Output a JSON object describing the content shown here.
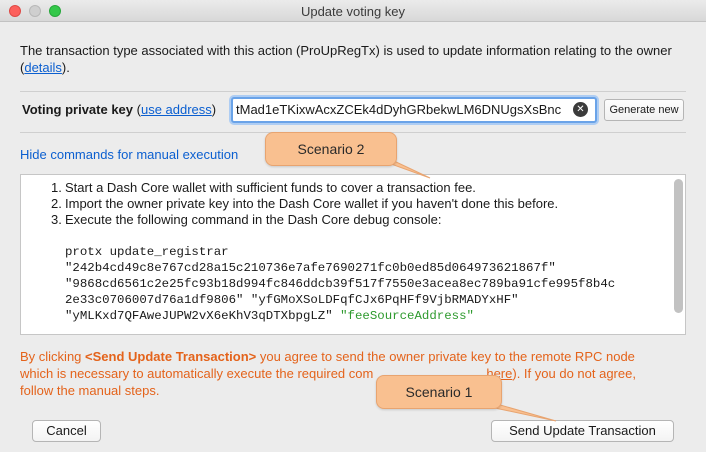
{
  "window": {
    "title": "Update voting key"
  },
  "intro": {
    "text_before_link": "The transaction type associated with this action (ProUpRegTx) is used to update information relating to the owner (",
    "link_text": "details",
    "text_after_link": ")."
  },
  "voting_key": {
    "label": "Voting private key",
    "use_address_prefix": " (",
    "use_address_link": "use address",
    "use_address_suffix": ")",
    "value": "tMad1eTKixwAcxZCEk4dDyhGRbekwLM6DNUgsXsBnc",
    "clear_icon": "clear-icon",
    "generate_label": "Generate new"
  },
  "manual": {
    "hide_link": "Hide commands for manual execution",
    "steps": [
      {
        "num": "1.",
        "text": "Start a Dash Core wallet with sufficient funds to cover a transaction fee."
      },
      {
        "num": "2.",
        "text": "Import the owner private key into the Dash Core wallet if you haven't done this before."
      },
      {
        "num": "3.",
        "text": "Execute the following command in the Dash Core debug console:"
      }
    ],
    "command": {
      "line1": "protx update_registrar",
      "line2": "\"242b4cd49c8e767cd28a15c210736e7afe7690271fc0b0ed85d064973621867f\"",
      "line3": "\"9868cd6561c2e25fc93b18d994fc846ddcb39f517f7550e3acea8ec789ba91cfe995f8b4c",
      "line4": "2e33c0706007d76a1df9806\" \"yfGMoXSoLDFqfCJx6PqHFf9VjbRMADYxHF\"",
      "line5_a": "\"yMLKxd7QFAweJUPW2vX6eKhV3qDTXbpgLZ\" ",
      "line5_b": "\"feeSourceAddress\""
    }
  },
  "warning": {
    "prefix": "By clicking ",
    "bold": "<Send Update Transaction>",
    "line1_rest": " you agree to send the owner private key to the remote RPC node",
    "line2_start": "which is necessary to automatically execute the required com",
    "line2_link": "here",
    "line2_end": "). If you do not agree,",
    "line3": "follow the manual steps."
  },
  "buttons": {
    "cancel": "Cancel",
    "send": "Send Update Transaction"
  },
  "annotations": {
    "scenario2": "Scenario 2",
    "scenario1": "Scenario 1"
  },
  "colors": {
    "link": "#0b5fd0",
    "warning": "#e4631b",
    "callout_fill": "#f9c090",
    "fee_source": "#2e9a2e"
  }
}
